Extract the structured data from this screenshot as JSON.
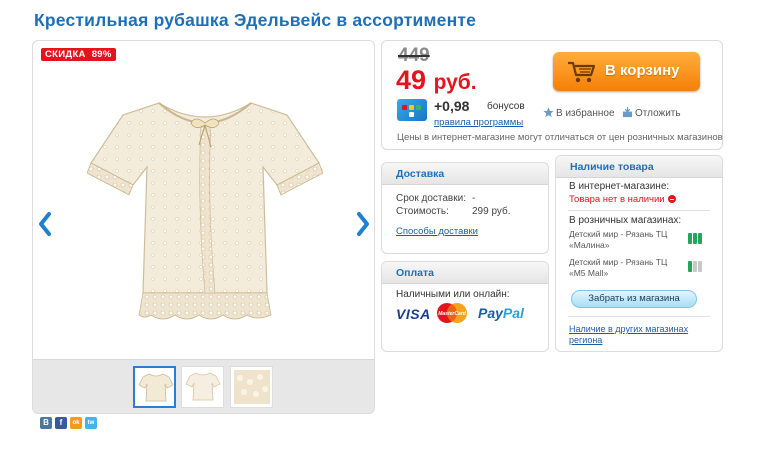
{
  "product": {
    "title": "Крестильная рубашка Эдельвейс в ассортименте",
    "discount_label": "СКИДКА",
    "discount_value": "89%"
  },
  "gallery": {
    "thumbnails": [
      "shirt-front",
      "shirt-front-small",
      "lace-detail"
    ],
    "active_thumbnail": 0
  },
  "price": {
    "old": "449",
    "new": "49",
    "currency": "руб.",
    "bonus_value": "+0,98",
    "bonus_label": "бонусов",
    "bonus_link": "правила программы",
    "note": "Цены в интернет-магазине могут отличаться от цен розничных магазинов"
  },
  "actions": {
    "cart_button": "В корзину",
    "favorite": "В избранное",
    "defer": "Отложить"
  },
  "delivery": {
    "header": "Доставка",
    "term_label": "Срок доставки:",
    "term_value": "-",
    "cost_label": "Стоимость:",
    "cost_value": "299 руб.",
    "methods_link": "Способы доставки"
  },
  "payment": {
    "header": "Оплата",
    "text": "Наличными или онлайн:",
    "visa": "VISA",
    "mastercard": "MasterCard",
    "paypal_1": "Pay",
    "paypal_2": "Pal"
  },
  "stock": {
    "header": "Наличие товара",
    "online_label": "В интернет-магазине:",
    "online_status": "Товара нет в наличии",
    "retail_label": "В розничных магазинах:",
    "stores": [
      {
        "line1": "Детский мир - Рязань ТЦ",
        "line2": "«Малина»",
        "level": 3
      },
      {
        "line1": "Детский мир - Рязань ТЦ",
        "line2": "«M5 Mall»",
        "level": 1
      }
    ],
    "pickup_button": "Забрать из магазина",
    "other_link_1": "Наличие в других магазинах",
    "other_link_2": "региона"
  },
  "social": [
    "В",
    "f",
    "ok",
    "tw"
  ],
  "colors": {
    "accent_blue": "#1f6fb6",
    "sale_red": "#e3141b",
    "cart_orange": "#f7941d",
    "stock_green": "#23a659"
  }
}
